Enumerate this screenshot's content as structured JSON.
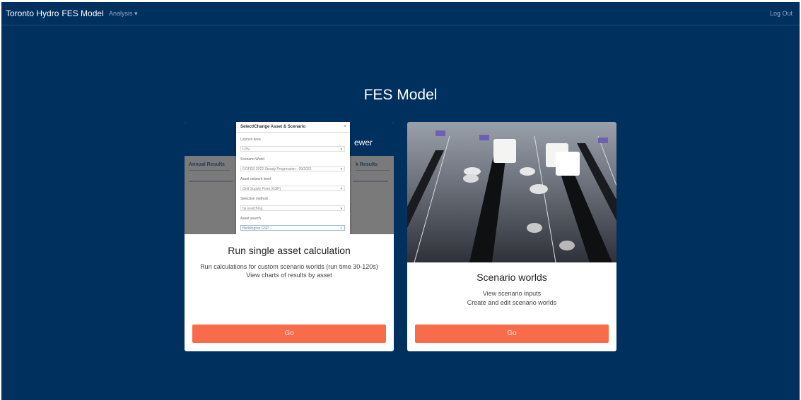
{
  "navbar": {
    "brand": "Toronto Hydro",
    "app_name": "FES Model",
    "analysis_menu": "Analysis",
    "caret": "▾",
    "logout": "Log Out"
  },
  "page": {
    "title": "FES Model"
  },
  "cards": [
    {
      "thumbnail": {
        "banner_text": "ewer",
        "left_heading": "Annual Results",
        "right_heading": "k Results",
        "modal": {
          "title": "Select/Change Asset & Scenario",
          "close": "×",
          "fields": [
            {
              "label": "Licence area",
              "value": "LPN"
            },
            {
              "label": "Scenario World",
              "value": "0 DFES 2022 Steady Progression - 09/2022"
            },
            {
              "label": "Asset network level",
              "value": "Grid Supply Point (GSP)"
            },
            {
              "label": "Selection method",
              "value": "by searching"
            },
            {
              "label": "Asset search",
              "value": "Beddington GSP"
            }
          ]
        }
      },
      "title": "Run single asset calculation",
      "lines": [
        "Run calculations for custom scenario worlds (run time 30-120s)",
        "View charts of results by asset"
      ],
      "button": "Go"
    },
    {
      "thumbnail": {
        "icon": "mixing-console-faders"
      },
      "title": "Scenario worlds",
      "lines": [
        "View scenario inputs",
        "Create and edit scenario worlds"
      ],
      "button": "Go"
    }
  ],
  "colors": {
    "background": "#00305e",
    "button": "#f86c4b"
  }
}
